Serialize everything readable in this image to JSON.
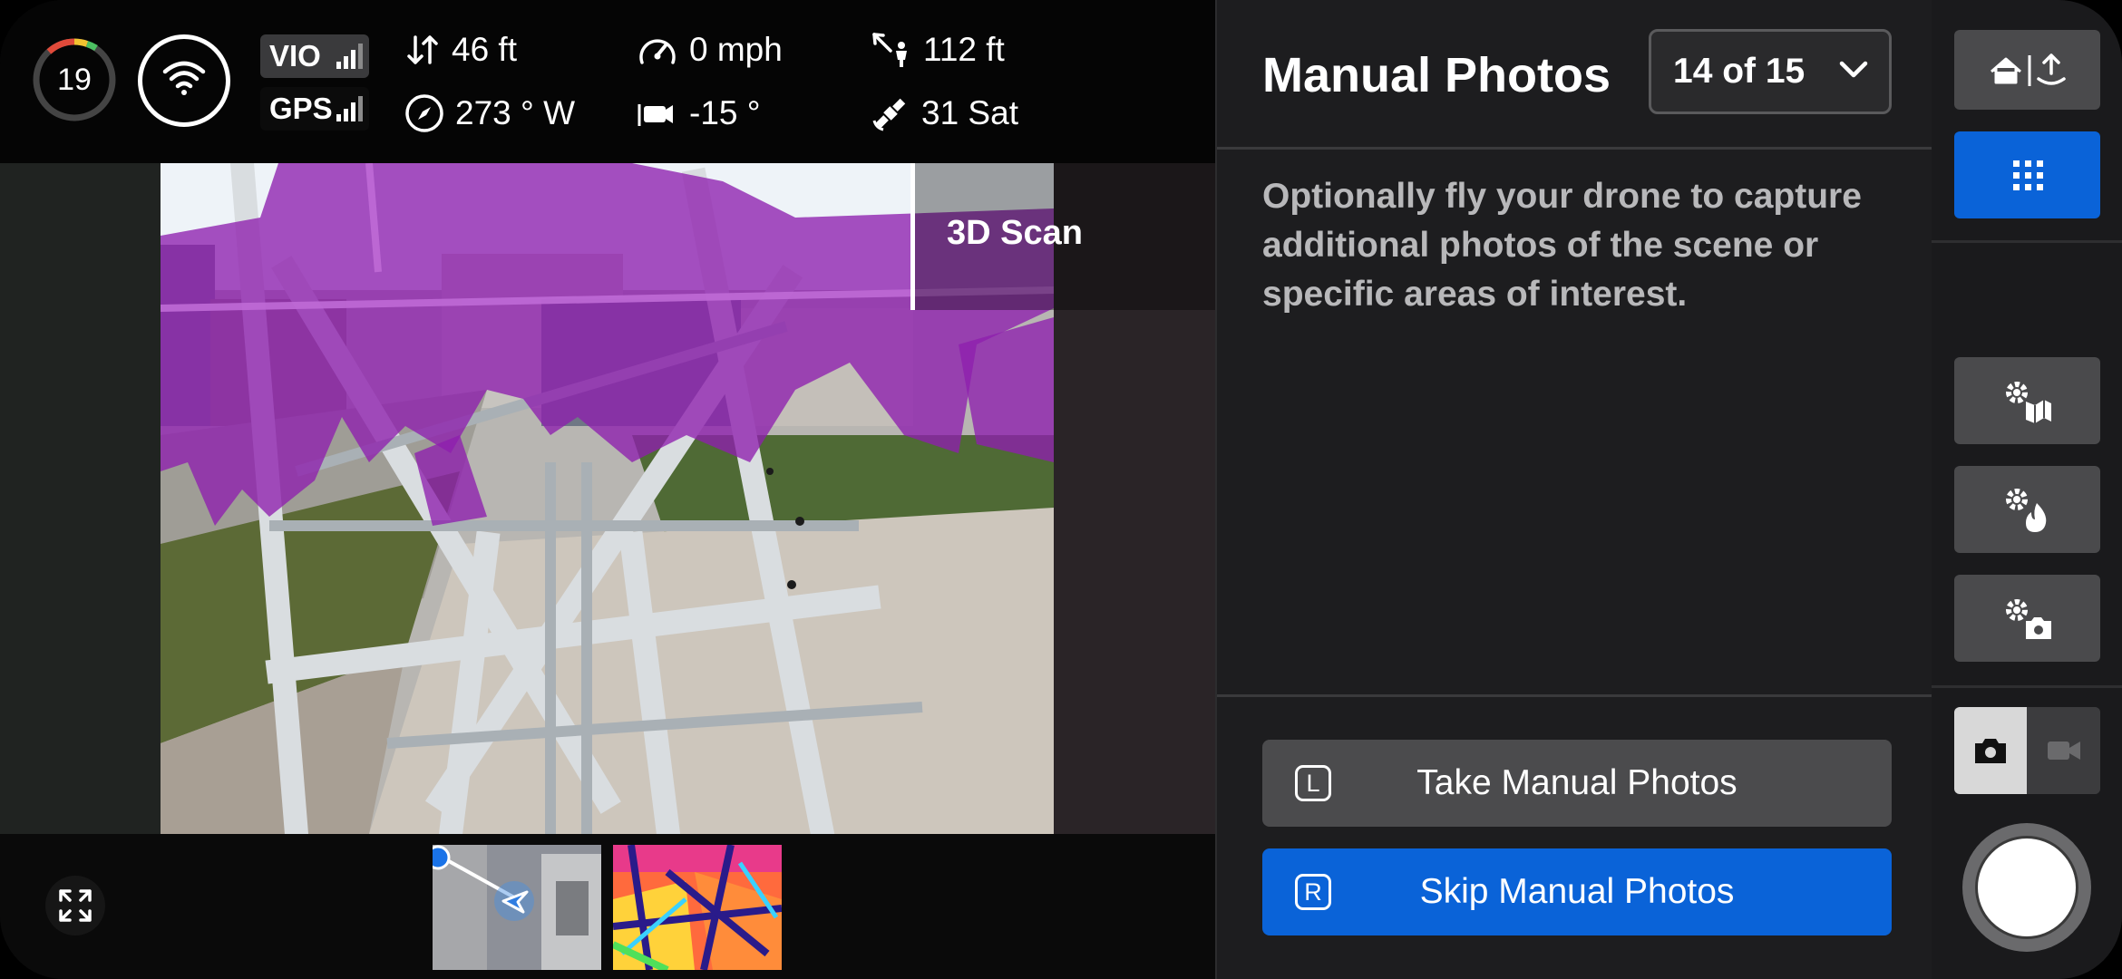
{
  "telemetry": {
    "battery": "19",
    "vio_label": "VIO",
    "gps_label": "GPS",
    "altitude": "46 ft",
    "heading": "273 ° W",
    "speed": "0 mph",
    "gimbal_pitch": "-15 °",
    "distance": "112 ft",
    "satellites": "31 Sat"
  },
  "viewport": {
    "mode_label": "3D Scan"
  },
  "panel": {
    "title": "Manual Photos",
    "step_indicator": "14 of 15",
    "description": "Optionally fly your drone to capture additional photos of the scene or specific areas of interest.",
    "take_key": "L",
    "take_label": "Take Manual Photos",
    "skip_key": "R",
    "skip_label": "Skip Manual Photos"
  },
  "colors": {
    "accent": "#0a63d8",
    "overlay": "#9b2fb8",
    "button_gray": "#4b4b4d"
  },
  "icons": {
    "rail": [
      "home-upload-icon",
      "grid-icon",
      "map-settings-icon",
      "flame-settings-icon",
      "camera-settings-icon"
    ],
    "capture_mode": [
      "photo-camera-icon",
      "video-camera-icon"
    ]
  },
  "capture_mode": "photo"
}
